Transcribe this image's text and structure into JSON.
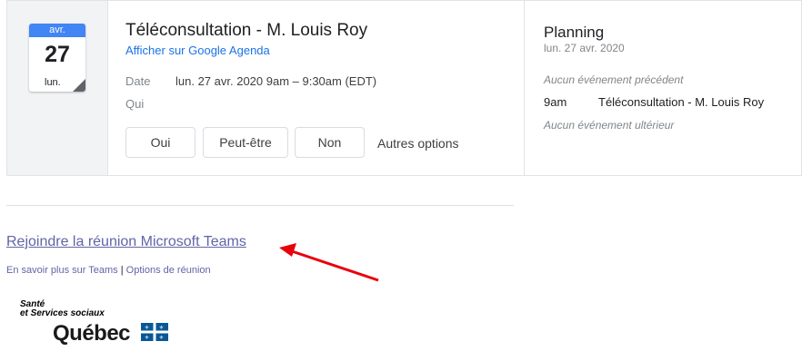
{
  "event": {
    "month": "avr.",
    "day": "27",
    "weekday": "lun.",
    "title": "Téléconsultation - M. Louis Roy",
    "gcal_link": "Afficher sur Google Agenda",
    "date_label": "Date",
    "date_value": "lun. 27 avr. 2020 9am – 9:30am (EDT)",
    "who_label": "Qui"
  },
  "rsvp": {
    "yes": "Oui",
    "maybe": "Peut-être",
    "no": "Non",
    "more": "Autres options"
  },
  "agenda": {
    "title": "Planning",
    "date": "lun. 27 avr. 2020",
    "no_prev": "Aucun événement précédent",
    "item_time": "9am",
    "item_title": "Téléconsultation - M. Louis Roy",
    "no_next": "Aucun événement ultérieur"
  },
  "teams": {
    "join": "Rejoindre la réunion Microsoft Teams",
    "learn_more": "En savoir plus sur Teams",
    "separator": "|",
    "options": "Options de réunion"
  },
  "logo": {
    "line1": "Santé",
    "line2": "et Services sociaux",
    "name": "Québec"
  },
  "colors": {
    "calendar_header": "#4285f4",
    "link_blue": "#1a73e8",
    "teams_purple": "#6264a7",
    "arrow_red": "#e8000b",
    "quebec_blue": "#095797"
  }
}
